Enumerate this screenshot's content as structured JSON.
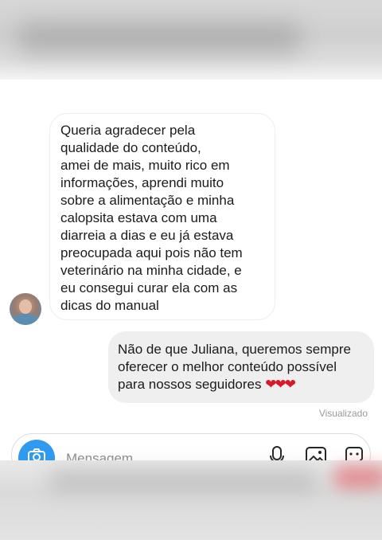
{
  "conversation": {
    "received_message": {
      "lines": [
        "Queria agradecer pela",
        "qualidade do conteúdo,",
        "amei de mais, muito rico em",
        "informações, aprendi muito",
        "sobre a alimentação e minha",
        "calopsita estava com uma",
        "diarreia a dias e eu já estava",
        "preocupada aqui pois não tem",
        "veterinário na minha cidade, e",
        "eu consegui curar ela com as",
        "dicas do manual"
      ]
    },
    "sent_message": {
      "lines": [
        "Não de que Juliana, queremos sempre",
        "oferecer o melhor conteúdo possível",
        "para nossos seguidores"
      ],
      "emoji": "❤❤❤"
    },
    "status": "Visualizado"
  },
  "composer": {
    "placeholder": "Mensagem",
    "icons": [
      "camera-icon",
      "microphone-icon",
      "image-icon",
      "sticker-icon"
    ]
  },
  "colors": {
    "camera_button": "#2f9af2",
    "sent_bubble": "#efefef",
    "heart": "#d7192a",
    "status_text": "#9a9a9a"
  }
}
